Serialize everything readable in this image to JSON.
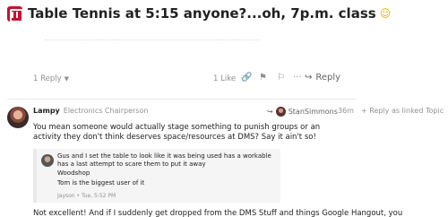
{
  "topic": {
    "title": "Table Tennis at 5:15 anyone?...oh, 7p.m. class",
    "emoji": "☺"
  },
  "topic_actions": {
    "replies": "1 Reply",
    "likes": "1 Like",
    "reply_label": "Reply"
  },
  "post": {
    "username": "Lampy",
    "user_title": "Electronics Chairperson",
    "reply_to_user": "StanSimmons",
    "date": "36m",
    "reply_as_linked_topic": "+ Reply as linked Topic",
    "body": "You mean someone would actually stage something to punish groups or an activity they don't think deserves space/resources at DMS? Say it ain't so!",
    "quote": {
      "text": "Gus and I set the table to look like it was being used has a workable has a last attempt to scare them to put it away",
      "line2": "Woodshop",
      "line3": "Tom is the biggest user of it",
      "meta": "Jayson • Tue, 5:52 PM"
    },
    "body2": "Not excellent! And if I suddenly get dropped from the DMS Stuff and things Google Hangout, you"
  }
}
